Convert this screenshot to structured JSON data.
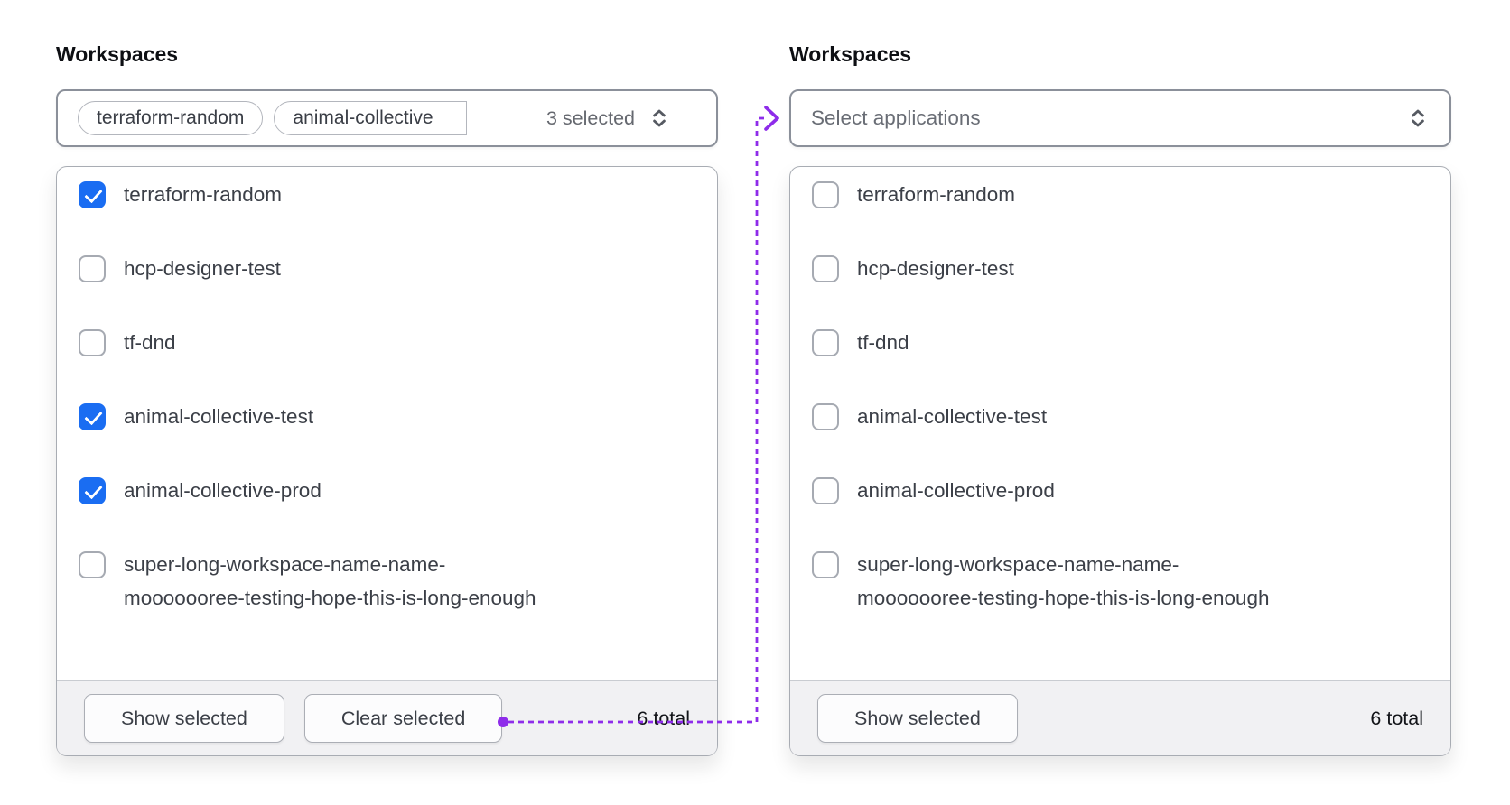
{
  "colors": {
    "accent_blue": "#1a6df2",
    "accent_purple": "#8e2cea",
    "trigger_border": "#8b909a",
    "panel_border": "#a8acb3",
    "muted_text": "#65686f",
    "item_text": "#3b3f47",
    "footer_bg": "#f1f1f3"
  },
  "left": {
    "title": "Workspaces",
    "trigger": {
      "tags": [
        "terraform-random",
        "animal-collective"
      ],
      "summary": "3 selected",
      "chevron_icon": "chevron-up-down"
    },
    "options": [
      {
        "label_lines": [
          "terraform-random"
        ],
        "checked": true
      },
      {
        "label_lines": [
          "hcp-designer-test"
        ],
        "checked": false
      },
      {
        "label_lines": [
          "tf-dnd"
        ],
        "checked": false
      },
      {
        "label_lines": [
          "animal-collective-test"
        ],
        "checked": true
      },
      {
        "label_lines": [
          "animal-collective-prod"
        ],
        "checked": true
      },
      {
        "label_lines": [
          "super-long-workspace-name-name-",
          "mooooooree-testing-hope-this-is-long-enough"
        ],
        "checked": false
      }
    ],
    "footer": {
      "show_button": "Show selected",
      "clear_button": "Clear selected",
      "total": "6 total"
    }
  },
  "right": {
    "title": "Workspaces",
    "trigger": {
      "placeholder": "Select applications",
      "chevron_icon": "chevron-up-down"
    },
    "options": [
      {
        "label_lines": [
          "terraform-random"
        ],
        "checked": false
      },
      {
        "label_lines": [
          "hcp-designer-test"
        ],
        "checked": false
      },
      {
        "label_lines": [
          "tf-dnd"
        ],
        "checked": false
      },
      {
        "label_lines": [
          "animal-collective-test"
        ],
        "checked": false
      },
      {
        "label_lines": [
          "animal-collective-prod"
        ],
        "checked": false
      },
      {
        "label_lines": [
          "super-long-workspace-name-name-",
          "mooooooree-testing-hope-this-is-long-enough"
        ],
        "checked": false
      }
    ],
    "footer": {
      "show_button": "Show selected",
      "total": "6 total"
    }
  }
}
